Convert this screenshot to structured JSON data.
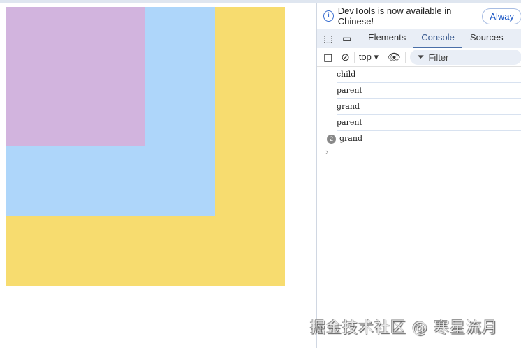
{
  "page": {
    "colors": {
      "grand": "#f7dc6f",
      "parent": "#aed6fa",
      "child": "#d2b4de"
    }
  },
  "devtools": {
    "infobar": {
      "message": "DevTools is now available in Chinese!",
      "button": "Alway"
    },
    "tabs": [
      {
        "label": "Elements"
      },
      {
        "label": "Console",
        "active": true
      },
      {
        "label": "Sources"
      }
    ],
    "toolbar": {
      "context": "top",
      "filter_placeholder": "Filter"
    },
    "console": [
      {
        "text": "child"
      },
      {
        "text": "parent"
      },
      {
        "text": "grand"
      },
      {
        "text": "parent"
      },
      {
        "text": "grand",
        "count": "2"
      }
    ]
  },
  "watermark": "掘金技术社区 @ 寒星流月"
}
